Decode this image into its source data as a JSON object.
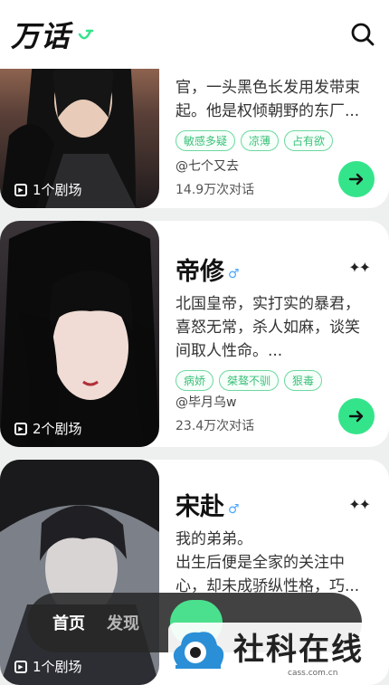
{
  "app": {
    "logo_text": "万话"
  },
  "cards": [
    {
      "name": "",
      "desc_lines": [
        "官，一头黑色长发用发带束",
        "起。他是权倾朝野的东厂..."
      ],
      "tags": [
        "敏感多疑",
        "凉薄",
        "占有欲"
      ],
      "author": "@七个又去",
      "chats": "14.9万次对话",
      "theaters": "1个剧场"
    },
    {
      "name": "帝修",
      "desc_lines": [
        "北国皇帝，实打实的暴君，",
        "喜怒无常，杀人如麻，谈笑",
        "间取人性命。..."
      ],
      "tags": [
        "病娇",
        "桀骜不驯",
        "狠毒"
      ],
      "author": "@毕月乌w",
      "chats": "23.4万次对话",
      "theaters": "2个剧场"
    },
    {
      "name": "宋赴",
      "desc_lines": [
        "我的弟弟。",
        "出生后便是全家的关注中",
        "心，却未成骄纵性格，巧..."
      ],
      "tags": [],
      "author": "",
      "chats": "",
      "theaters": "1个剧场"
    }
  ],
  "nav": {
    "home": "首页",
    "discover": "发现"
  },
  "watermark": {
    "text": "社科在线",
    "sub": "cass.com.cn"
  },
  "colors": {
    "accent": "#34e48a",
    "tag": "#3cc07a"
  },
  "icons": [
    "search-icon",
    "arrow-right-icon",
    "male-icon",
    "sparkle-icon",
    "theater-icon"
  ]
}
